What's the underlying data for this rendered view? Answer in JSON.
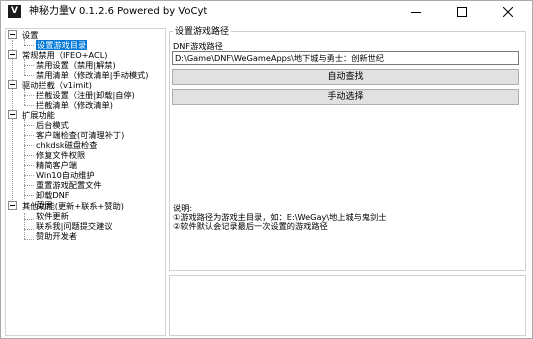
{
  "window": {
    "app_icon_letter": "V",
    "title": "神秘力量V 0.1.2.6  Powered by VoCyt"
  },
  "tree": {
    "settings": "设置",
    "settings_children": [
      "设置游戏目录"
    ],
    "common_ban": "常规禁用（IFEO+ACL)",
    "common_ban_children": [
      "禁用设置（禁用|解禁)",
      "禁用清单（修改清单|手动模式)"
    ],
    "driver_block": "驱动拦截（v1imit)",
    "driver_block_children": [
      "拦截设置（注册|卸载|自停)",
      "拦截清单（修改清单)"
    ],
    "extend": "扩展功能",
    "extend_children": [
      "后台模式",
      "客户端检查(可清理补丁)",
      "chkdsk磁盘检查",
      "修复文件权限",
      "精简客户端",
      "Win10自动维护",
      "重置游戏配置文件",
      "卸载DNF",
      "蓝屏"
    ],
    "other": "其他功能(更新+联系+赞助)",
    "other_children": [
      "软件更新",
      "联系我|问题提交建议",
      "赞助开发者"
    ]
  },
  "panel": {
    "group_title": "设置游戏路径",
    "path_label": "DNF游戏路径",
    "path_value": "D:\\Game\\DNF\\WeGameApps\\地下城与勇士：创新世纪",
    "auto_find_label": "自动查找",
    "manual_select_label": "手动选择",
    "notes": [
      "说明:",
      "①游戏路径为游戏主目录，如：E:\\WeGay\\地上城与鬼剑士",
      "②软件默认会记录最后一次设置的游戏路径"
    ]
  },
  "log": ""
}
